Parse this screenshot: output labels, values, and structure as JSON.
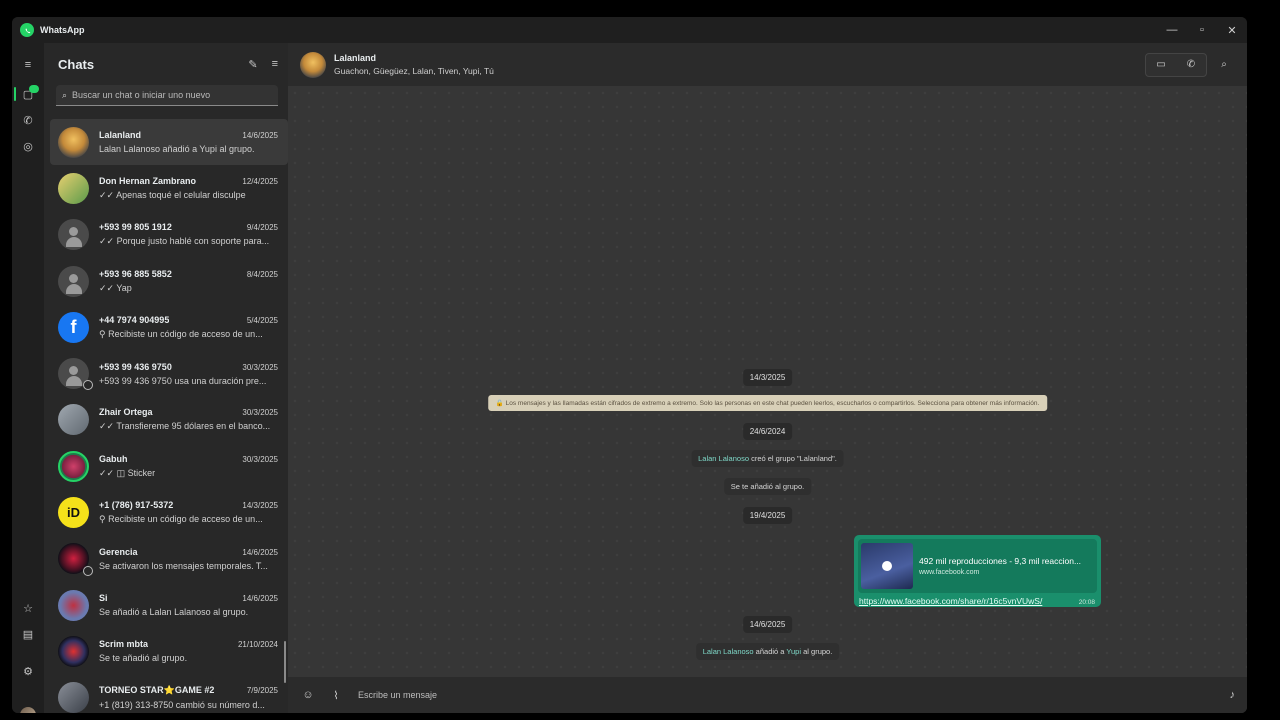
{
  "window": {
    "title": "WhatsApp"
  },
  "sidebar": {
    "title": "Chats",
    "search_placeholder": "Buscar un chat o iniciar uno nuevo",
    "chats": [
      {
        "name": "Lalanland",
        "date": "14/6/2025",
        "preview": "Lalan Lalanoso añadió a Yupi al grupo.",
        "active": true
      },
      {
        "name": "Don Hernan Zambrano",
        "date": "12/4/2025",
        "preview": "✓✓ Apenas toqué el celular disculpe"
      },
      {
        "name": "+593 99 805 1912",
        "date": "9/4/2025",
        "preview": "✓✓ Porque justo hablé con soporte para..."
      },
      {
        "name": "+593 96 885 5852",
        "date": "8/4/2025",
        "preview": "✓✓ Yap"
      },
      {
        "name": "+44 7974 904995",
        "date": "5/4/2025",
        "preview": "⚲ Recibiste un código de acceso de un..."
      },
      {
        "name": "+593 99 436 9750",
        "date": "30/3/2025",
        "preview": "+593 99 436 9750 usa una duración pre..."
      },
      {
        "name": "Zhair Ortega",
        "date": "30/3/2025",
        "preview": "✓✓ Transfiereme 95 dólares en el banco..."
      },
      {
        "name": "Gabuh",
        "date": "30/3/2025",
        "preview": "✓✓ ◫ Sticker"
      },
      {
        "name": "+1 (786) 917-5372",
        "date": "14/3/2025",
        "preview": "⚲ Recibiste un código de acceso de un..."
      },
      {
        "name": "Gerencia",
        "date": "14/6/2025",
        "preview": "Se activaron los mensajes temporales. T..."
      },
      {
        "name": "Si",
        "date": "14/6/2025",
        "preview": "Se añadió a Lalan Lalanoso al grupo."
      },
      {
        "name": "Scrim mbta",
        "date": "21/10/2024",
        "preview": "Se te añadió al grupo."
      },
      {
        "name": "TORNEO  STAR⭐GAME #2",
        "date": "7/9/2025",
        "preview": "+1 (819) 313-8750 cambió su número d..."
      }
    ]
  },
  "conversation": {
    "group_name": "Lalanland",
    "members": "Guachon, Güegüez, Lalan, Tiven, Yupi, Tú",
    "date_1": "14/3/2025",
    "encryption_notice": "🔒 Los mensajes y las llamadas están cifrados de extremo a extremo. Solo las personas en este chat pueden leerlos, escucharlos o compartirlos. Selecciona para obtener más información.",
    "date_2": "24/6/2024",
    "sys_1_name": "Lalan Lalanoso",
    "sys_1_rest": " creó el grupo \"Lalanland\".",
    "sys_2": "Se te añadió al grupo.",
    "date_3": "19/4/2025",
    "link_title": "492 mil reproducciones - 9,3 mil reaccion...",
    "link_domain": "www.facebook.com",
    "link_url": "https://www.facebook.com/share/r/16c5vnVUwS/",
    "link_time": "20:08",
    "date_4": "14/6/2025",
    "sys_3_name": "Lalan Lalanoso",
    "sys_3_mid": " añadió a ",
    "sys_3_name2": "Yupi",
    "sys_3_rest": " al grupo.",
    "composer_placeholder": "Escribe un mensaje"
  }
}
